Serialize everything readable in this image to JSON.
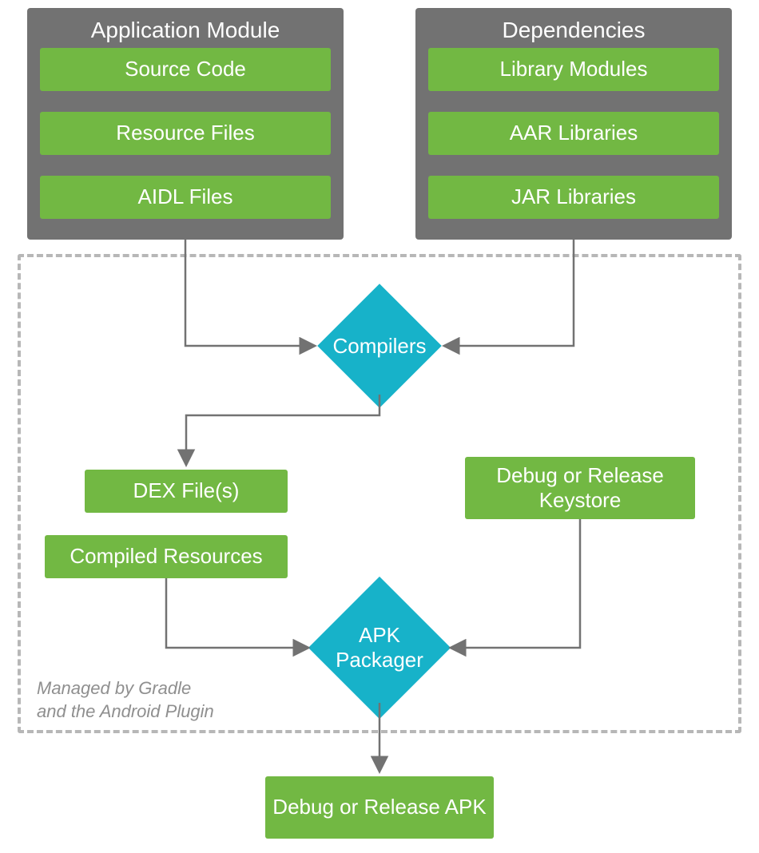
{
  "containers": {
    "app_module": {
      "title": "Application Module",
      "items": [
        "Source Code",
        "Resource Files",
        "AIDL Files"
      ]
    },
    "dependencies": {
      "title": "Dependencies",
      "items": [
        "Library Modules",
        "AAR Libraries",
        "JAR Libraries"
      ]
    }
  },
  "nodes": {
    "compilers": "Compilers",
    "dex_files": "DEX File(s)",
    "compiled_resources": "Compiled Resources",
    "keystore": "Debug or Release Keystore",
    "apk_packager": "APK Packager",
    "output_apk": "Debug or Release APK"
  },
  "caption_line1": "Managed by Gradle",
  "caption_line2": "and the Android Plugin",
  "colors": {
    "container_bg": "#727272",
    "green": "#72b843",
    "cyan": "#17b2c9",
    "dash": "#b7b7b7",
    "arrow": "#727272"
  }
}
